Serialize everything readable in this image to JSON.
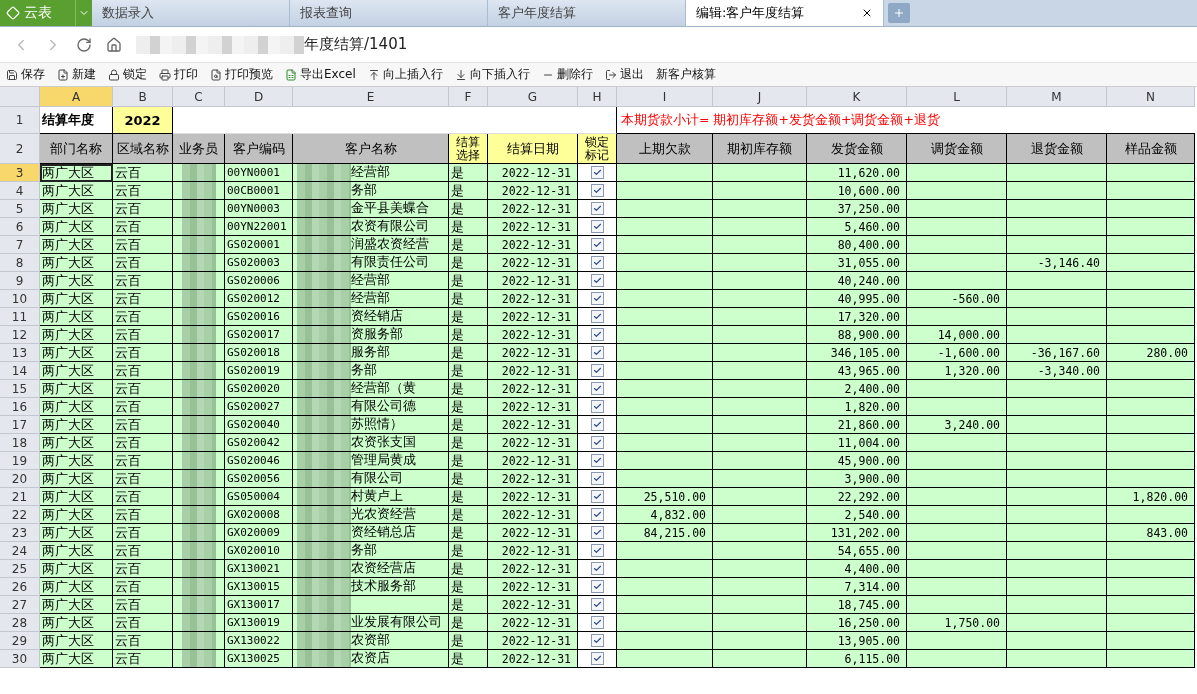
{
  "app": {
    "name": "云表"
  },
  "tabs": [
    {
      "label": "数据录入",
      "selected": false,
      "closable": false
    },
    {
      "label": "报表查询",
      "selected": false,
      "closable": false
    },
    {
      "label": "客户年度结算",
      "selected": false,
      "closable": false
    },
    {
      "label": "编辑:客户年度结算",
      "selected": true,
      "closable": true
    }
  ],
  "address": "年度结算/1401",
  "toolbar": [
    {
      "label": "保存",
      "kind": "icon"
    },
    {
      "label": "新建",
      "kind": "icon"
    },
    {
      "label": "锁定",
      "kind": "icon"
    },
    {
      "label": "打印",
      "kind": "icon"
    },
    {
      "label": "打印预览",
      "kind": "icon"
    },
    {
      "label": "导出Excel",
      "kind": "icon"
    },
    {
      "label": "向上插入行",
      "kind": "icon"
    },
    {
      "label": "向下插入行",
      "kind": "icon"
    },
    {
      "label": "删除行",
      "kind": "icon"
    },
    {
      "label": "退出",
      "kind": "icon"
    },
    {
      "label": "新客户核算",
      "kind": "text"
    }
  ],
  "columns": [
    {
      "label": "A",
      "selected": true
    },
    {
      "label": "B",
      "selected": false
    },
    {
      "label": "C",
      "selected": false
    },
    {
      "label": "D",
      "selected": false
    },
    {
      "label": "E",
      "selected": false
    },
    {
      "label": "F",
      "selected": false
    },
    {
      "label": "G",
      "selected": false
    },
    {
      "label": "H",
      "selected": false
    },
    {
      "label": "I",
      "selected": false
    },
    {
      "label": "J",
      "selected": false
    },
    {
      "label": "K",
      "selected": false
    },
    {
      "label": "L",
      "selected": false
    },
    {
      "label": "M",
      "selected": false
    },
    {
      "label": "N",
      "selected": false
    }
  ],
  "row1": {
    "number": "1",
    "label": "结算年度",
    "year": "2022",
    "formula": "本期货款小计=  期初库存额+发货金额+调货金额+退货"
  },
  "header_row": {
    "number": "2",
    "cells": [
      "部门名称",
      "区域名称",
      "业务员",
      "客户编码",
      "客户名称",
      "结算选择",
      "结算日期",
      "锁定标记",
      "上期欠款",
      "期初库存额",
      "发货金额",
      "调货金额",
      "退货金额",
      "样品金额"
    ]
  },
  "rows": [
    {
      "number": "3",
      "selected": true,
      "dept": "两广大区",
      "region": "云百",
      "code": "00YN0001",
      "name": "经营部",
      "settle": "是",
      "date": "2022-12-31",
      "locked": true,
      "shipped": "11,620.00"
    },
    {
      "number": "4",
      "selected": false,
      "dept": "两广大区",
      "region": "云百",
      "code": "00CB0001",
      "name": "务部",
      "settle": "是",
      "date": "2022-12-31",
      "locked": true,
      "shipped": "10,600.00"
    },
    {
      "number": "5",
      "selected": false,
      "dept": "两广大区",
      "region": "云百",
      "code": "00YN0003",
      "name": "金平县美蝶合",
      "settle": "是",
      "date": "2022-12-31",
      "locked": true,
      "shipped": "37,250.00"
    },
    {
      "number": "6",
      "selected": false,
      "dept": "两广大区",
      "region": "云百",
      "code": "00YN22001",
      "name": "农资有限公司",
      "settle": "是",
      "date": "2022-12-31",
      "locked": true,
      "shipped": "5,460.00"
    },
    {
      "number": "7",
      "selected": false,
      "dept": "两广大区",
      "region": "云百",
      "code": "GS020001",
      "name": "润盛农资经营",
      "settle": "是",
      "date": "2022-12-31",
      "locked": true,
      "shipped": "80,400.00"
    },
    {
      "number": "8",
      "selected": false,
      "dept": "两广大区",
      "region": "云百",
      "code": "GS020003",
      "name": "有限责任公司",
      "settle": "是",
      "date": "2022-12-31",
      "locked": true,
      "shipped": "31,055.00",
      "returned": "-3,146.40"
    },
    {
      "number": "9",
      "selected": false,
      "dept": "两广大区",
      "region": "云百",
      "code": "GS020006",
      "name": "经营部",
      "settle": "是",
      "date": "2022-12-31",
      "locked": true,
      "shipped": "40,240.00"
    },
    {
      "number": "10",
      "selected": false,
      "dept": "两广大区",
      "region": "云百",
      "code": "GS020012",
      "name": "经营部",
      "settle": "是",
      "date": "2022-12-31",
      "locked": true,
      "shipped": "40,995.00",
      "transfer": "-560.00"
    },
    {
      "number": "11",
      "selected": false,
      "dept": "两广大区",
      "region": "云百",
      "code": "GS020016",
      "name": "资经销店",
      "settle": "是",
      "date": "2022-12-31",
      "locked": true,
      "shipped": "17,320.00"
    },
    {
      "number": "12",
      "selected": false,
      "dept": "两广大区",
      "region": "云百",
      "code": "GS020017",
      "name": "资服务部",
      "settle": "是",
      "date": "2022-12-31",
      "locked": true,
      "shipped": "88,900.00",
      "transfer": "14,000.00"
    },
    {
      "number": "13",
      "selected": false,
      "dept": "两广大区",
      "region": "云百",
      "code": "GS020018",
      "name": "服务部",
      "settle": "是",
      "date": "2022-12-31",
      "locked": true,
      "shipped": "346,105.00",
      "transfer": "-1,600.00",
      "returned": "-36,167.60",
      "sample": "280.00"
    },
    {
      "number": "14",
      "selected": false,
      "dept": "两广大区",
      "region": "云百",
      "code": "GS020019",
      "name": "务部",
      "settle": "是",
      "date": "2022-12-31",
      "locked": true,
      "shipped": "43,965.00",
      "transfer": "1,320.00",
      "returned": "-3,340.00"
    },
    {
      "number": "15",
      "selected": false,
      "dept": "两广大区",
      "region": "云百",
      "code": "GS020020",
      "name": "经营部（黄",
      "settle": "是",
      "date": "2022-12-31",
      "locked": true,
      "shipped": "2,400.00"
    },
    {
      "number": "16",
      "selected": false,
      "dept": "两广大区",
      "region": "云百",
      "code": "GS020027",
      "name": "有限公司德",
      "settle": "是",
      "date": "2022-12-31",
      "locked": true,
      "shipped": "1,820.00"
    },
    {
      "number": "17",
      "selected": false,
      "dept": "两广大区",
      "region": "云百",
      "code": "GS020040",
      "name": "苏照情）",
      "settle": "是",
      "date": "2022-12-31",
      "locked": true,
      "shipped": "21,860.00",
      "transfer": "3,240.00"
    },
    {
      "number": "18",
      "selected": false,
      "dept": "两广大区",
      "region": "云百",
      "code": "GS020042",
      "name": "农资张支国",
      "settle": "是",
      "date": "2022-12-31",
      "locked": true,
      "shipped": "11,004.00"
    },
    {
      "number": "19",
      "selected": false,
      "dept": "两广大区",
      "region": "云百",
      "code": "GS020046",
      "name": "管理局黄成",
      "settle": "是",
      "date": "2022-12-31",
      "locked": true,
      "shipped": "45,900.00"
    },
    {
      "number": "20",
      "selected": false,
      "dept": "两广大区",
      "region": "云百",
      "code": "GS020056",
      "name": "有限公司",
      "settle": "是",
      "date": "2022-12-31",
      "locked": true,
      "shipped": "3,900.00"
    },
    {
      "number": "21",
      "selected": false,
      "dept": "两广大区",
      "region": "云百",
      "code": "GS050004",
      "name": "村黄卢上",
      "settle": "是",
      "date": "2022-12-31",
      "locked": true,
      "prev_debt": "25,510.00",
      "shipped": "22,292.00",
      "sample": "1,820.00"
    },
    {
      "number": "22",
      "selected": false,
      "dept": "两广大区",
      "region": "云百",
      "code": "GX020008",
      "name": "光农资经营",
      "settle": "是",
      "date": "2022-12-31",
      "locked": true,
      "prev_debt": "4,832.00",
      "shipped": "2,540.00"
    },
    {
      "number": "23",
      "selected": false,
      "dept": "两广大区",
      "region": "云百",
      "code": "GX020009",
      "name": "资经销总店",
      "settle": "是",
      "date": "2022-12-31",
      "locked": true,
      "prev_debt": "84,215.00",
      "shipped": "131,202.00",
      "sample": "843.00"
    },
    {
      "number": "24",
      "selected": false,
      "dept": "两广大区",
      "region": "云百",
      "code": "GX020010",
      "name": "务部",
      "settle": "是",
      "date": "2022-12-31",
      "locked": true,
      "shipped": "54,655.00"
    },
    {
      "number": "25",
      "selected": false,
      "dept": "两广大区",
      "region": "云百",
      "code": "GX130021",
      "name": "农资经营店",
      "settle": "是",
      "date": "2022-12-31",
      "locked": true,
      "shipped": "4,400.00"
    },
    {
      "number": "26",
      "selected": false,
      "dept": "两广大区",
      "region": "云百",
      "code": "GX130015",
      "name": "技术服务部",
      "settle": "是",
      "date": "2022-12-31",
      "locked": true,
      "shipped": "7,314.00"
    },
    {
      "number": "27",
      "selected": false,
      "dept": "两广大区",
      "region": "云百",
      "code": "GX130017",
      "settle": "是",
      "date": "2022-12-31",
      "locked": true,
      "shipped": "18,745.00"
    },
    {
      "number": "28",
      "selected": false,
      "dept": "两广大区",
      "region": "云百",
      "code": "GX130019",
      "name": "业发展有限公司",
      "settle": "是",
      "date": "2022-12-31",
      "locked": true,
      "shipped": "16,250.00",
      "transfer": "1,750.00"
    },
    {
      "number": "29",
      "selected": false,
      "dept": "两广大区",
      "region": "云百",
      "code": "GX130022",
      "name": "农资部",
      "settle": "是",
      "date": "2022-12-31",
      "locked": true,
      "shipped": "13,905.00"
    },
    {
      "number": "30",
      "selected": false,
      "dept": "两广大区",
      "region": "云百",
      "code": "GX130025",
      "name": "农资店",
      "settle": "是",
      "date": "2022-12-31",
      "locked": true,
      "shipped": "6,115.00"
    }
  ]
}
